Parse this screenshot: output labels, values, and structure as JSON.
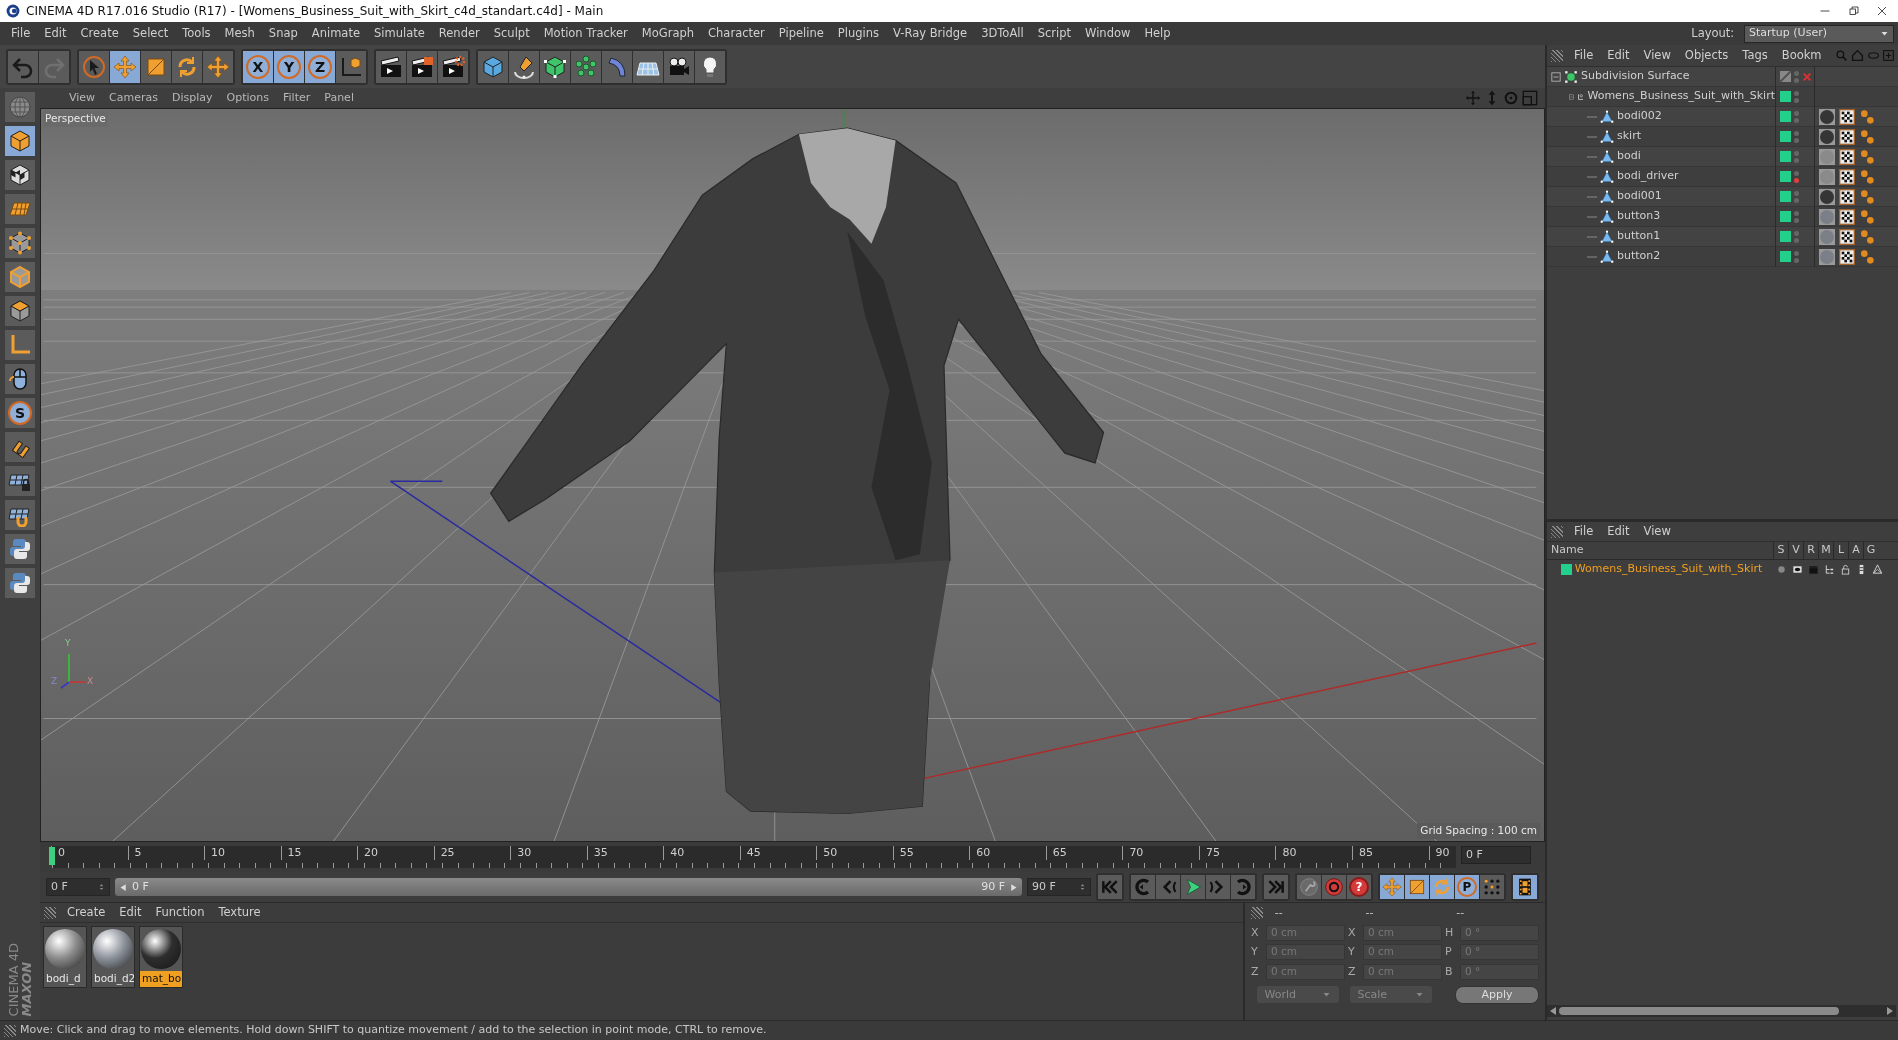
{
  "window": {
    "title": "CINEMA 4D R17.016 Studio (R17) - [Womens_Business_Suit_with_Skirt_c4d_standart.c4d] - Main"
  },
  "menu": [
    "File",
    "Edit",
    "Create",
    "Select",
    "Tools",
    "Mesh",
    "Snap",
    "Animate",
    "Simulate",
    "Render",
    "Sculpt",
    "Motion Tracker",
    "MoGraph",
    "Character",
    "Pipeline",
    "Plugins",
    "V-Ray Bridge",
    "3DToAll",
    "Script",
    "Window",
    "Help"
  ],
  "layout": {
    "label": "Layout:",
    "value": "Startup (User)"
  },
  "toolbar": [
    [
      {
        "kind": "undo",
        "selected": false
      },
      {
        "kind": "redo",
        "selected": false
      }
    ],
    [
      {
        "kind": "select",
        "selected": false
      },
      {
        "kind": "move",
        "selected": true
      },
      {
        "kind": "scale",
        "selected": false
      },
      {
        "kind": "rotate",
        "selected": false
      },
      {
        "kind": "transform",
        "selected": false
      }
    ],
    [
      {
        "kind": "axis",
        "label": "X",
        "selected": true
      },
      {
        "kind": "axis",
        "label": "Y",
        "selected": true
      },
      {
        "kind": "axis",
        "label": "Z",
        "selected": true
      },
      {
        "kind": "coords",
        "selected": false
      }
    ],
    [
      {
        "kind": "render_view",
        "selected": false
      },
      {
        "kind": "render",
        "selected": false
      },
      {
        "kind": "render_settings",
        "selected": false
      }
    ],
    [
      {
        "kind": "cube",
        "selected": false
      },
      {
        "kind": "pen",
        "selected": false
      },
      {
        "kind": "subdivision",
        "selected": false
      },
      {
        "kind": "cloner",
        "selected": false
      },
      {
        "kind": "deformer",
        "selected": false
      },
      {
        "kind": "floor",
        "selected": false
      },
      {
        "kind": "camera",
        "selected": false
      },
      {
        "kind": "light",
        "selected": false
      }
    ]
  ],
  "left_tools": [
    {
      "kind": "model",
      "selected": false
    },
    {
      "kind": "object",
      "selected": true
    },
    {
      "kind": "texture",
      "selected": false
    },
    {
      "kind": "workplane",
      "selected": false
    },
    {
      "kind": "points",
      "selected": false
    },
    {
      "kind": "edges",
      "selected": false
    },
    {
      "kind": "polygons",
      "selected": false
    },
    {
      "kind": "axis_mode",
      "selected": false
    },
    {
      "kind": "tweak",
      "selected": false
    },
    {
      "kind": "solo",
      "label": "S",
      "selected": false
    },
    {
      "kind": "snap",
      "selected": false
    },
    {
      "kind": "grid_lock",
      "selected": false
    },
    {
      "kind": "grid_snap",
      "selected": false
    },
    {
      "kind": "python",
      "selected": false
    },
    {
      "kind": "python",
      "selected": false
    }
  ],
  "logo": [
    "MAXON",
    "CINEMA 4D"
  ],
  "viewport": {
    "menu": [
      "View",
      "Cameras",
      "Display",
      "Options",
      "Filter",
      "Panel"
    ],
    "camera": "Perspective",
    "grid_spacing": "Grid Spacing : 100 cm",
    "axes": [
      "Y",
      "Z",
      "X"
    ]
  },
  "timeline": {
    "ticks": [
      "0",
      "5",
      "10",
      "15",
      "20",
      "25",
      "30",
      "35",
      "40",
      "45",
      "50",
      "55",
      "60",
      "65",
      "70",
      "75",
      "80",
      "85",
      "90"
    ],
    "current_frame": "0 F"
  },
  "frame_controls": {
    "start": "0 F",
    "range": {
      "start": "0 F",
      "end": "90 F",
      "level": 1
    },
    "end": "90 F",
    "buttons": [
      [
        {
          "kind": "first",
          "selected": false
        }
      ],
      [
        {
          "kind": "prev_key",
          "selected": false
        },
        {
          "kind": "prev_frame",
          "selected": false
        },
        {
          "kind": "play",
          "selected": false
        },
        {
          "kind": "next_frame",
          "selected": false
        },
        {
          "kind": "next_key",
          "selected": false
        }
      ],
      [
        {
          "kind": "last",
          "selected": false
        }
      ],
      [
        {
          "kind": "record",
          "selected": false
        },
        {
          "kind": "autokey",
          "selected": false
        },
        {
          "kind": "keyset",
          "label": "?",
          "selected": false
        }
      ],
      [
        {
          "kind": "move",
          "selected": true
        },
        {
          "kind": "scale",
          "selected": true
        },
        {
          "kind": "rotate",
          "selected": true
        },
        {
          "kind": "param",
          "label": "P",
          "selected": true
        },
        {
          "kind": "pla",
          "selected": false
        }
      ],
      [
        {
          "kind": "film",
          "selected": true
        }
      ]
    ]
  },
  "materials": {
    "menu": [
      "Create",
      "Edit",
      "Function",
      "Texture"
    ],
    "items": [
      {
        "name": "bodi_d",
        "color": "#8c8c8c",
        "selected": false
      },
      {
        "name": "bodi_d2",
        "color": "#8e949c",
        "selected": false
      },
      {
        "name": "mat_bo",
        "color": "#2e2e2e",
        "selected": true
      }
    ]
  },
  "coordinates": {
    "headers": [
      "--",
      "--",
      "--"
    ],
    "rows": [
      {
        "axis": "X",
        "position": "0 cm",
        "size_axis": "X",
        "size": "0 cm",
        "rotation_axis": "H",
        "rotation": "0 °"
      },
      {
        "axis": "Y",
        "position": "0 cm",
        "size_axis": "Y",
        "size": "0 cm",
        "rotation_axis": "P",
        "rotation": "0 °"
      },
      {
        "axis": "Z",
        "position": "0 cm",
        "size_axis": "Z",
        "size": "0 cm",
        "rotation_axis": "B",
        "rotation": "0 °"
      }
    ],
    "dropdowns": [
      "World",
      "Scale"
    ],
    "apply": "Apply"
  },
  "objects": {
    "menu": [
      "File",
      "Edit",
      "View",
      "Objects",
      "Tags",
      "Bookm"
    ],
    "tree": [
      {
        "name": "Subdivision Surface",
        "kind": "subdivision",
        "enabled": false,
        "children": [
          {
            "name": "Womens_Business_Suit_with_Skirt",
            "kind": "null",
            "children": [
              {
                "name": "bodi002",
                "kind": "polygon",
                "render_visible": true,
                "material": {
                  "color": "#353535"
                }
              },
              {
                "name": "skirt",
                "kind": "polygon",
                "render_visible": true,
                "material": {
                  "color": "#353535"
                }
              },
              {
                "name": "bodi",
                "kind": "polygon",
                "render_visible": true,
                "material": {
                  "color": "#8a8a8a"
                }
              },
              {
                "name": "bodi_driver",
                "kind": "polygon",
                "render_visible": false,
                "material": {
                  "color": "#8a8a8a"
                }
              },
              {
                "name": "bodi001",
                "kind": "polygon",
                "render_visible": true,
                "material": {
                  "color": "#353535"
                }
              },
              {
                "name": "button3",
                "kind": "polygon",
                "render_visible": true,
                "material": {
                  "color": "#7b8088"
                }
              },
              {
                "name": "button1",
                "kind": "polygon",
                "render_visible": true,
                "material": {
                  "color": "#7b8088"
                }
              },
              {
                "name": "button2",
                "kind": "polygon",
                "render_visible": true,
                "material": {
                  "color": "#7b8088"
                }
              }
            ]
          }
        ]
      }
    ]
  },
  "layers": {
    "menu": [
      "File",
      "Edit",
      "View"
    ],
    "columns": [
      "Name",
      "S",
      "V",
      "R",
      "M",
      "L",
      "A",
      "G"
    ],
    "rows": [
      {
        "name": "Womens_Business_Suit_with_Skirt"
      }
    ]
  },
  "status": "Move: Click and drag to move elements. Hold down SHIFT to quantize movement / add to the selection in point mode, CTRL to remove."
}
